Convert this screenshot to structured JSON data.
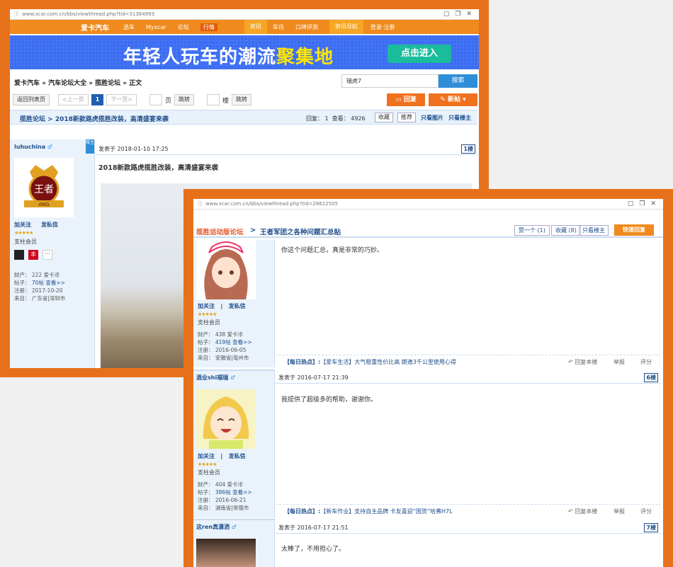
{
  "back": {
    "url": "www.xcar.com.cn/bbs/viewthread.php?tid=31384993",
    "topnav": [
      "爱卡汽车",
      "选车",
      "Myxcar",
      "论坛",
      "行情",
      "资讯",
      "车讯",
      "口碑评测",
      "资讯导航",
      "登录·注册"
    ],
    "banner": {
      "lead": "年轻人玩车的潮流",
      "accent": "聚集地",
      "cta": "点击进入"
    },
    "breadcrumb": "爱卡汽车 » 汽车论坛大全 » 揽胜论坛 » 正文",
    "search": {
      "value": "瑞虎7",
      "button": "搜索"
    },
    "pager": {
      "back": "返回列表页",
      "prev": "<上一页",
      "current": "1",
      "next": "下一页>",
      "page_label": "页",
      "go1": "跳转",
      "floor_label": "楼",
      "go2": "跳转"
    },
    "reply_btn": "回复",
    "new_btn": "新帖",
    "thread": {
      "forum": "揽胜论坛",
      "sep": ">",
      "title": "2018新款路虎揽胜改装，高清盛宴来袭",
      "replies": "回复： 1",
      "views": "查看： 4926",
      "fav": "收藏",
      "recommend": "推荐",
      "only_img": "只看图片",
      "only_owner": "只看楼主"
    },
    "post": {
      "user": "luhuchina",
      "badge": "楼主",
      "follow": "加关注",
      "pm": "发私信",
      "stars": "★★★★★",
      "role": "支柱会员",
      "wealth_label": "财产：",
      "wealth": "222 爱卡币",
      "posts_label": "帖子：",
      "posts": "70帖",
      "view": "查看>>",
      "reg_label": "注册：",
      "reg": "2017-10-20",
      "from_label": "来自：",
      "from": "广东省|深圳市",
      "date": "发表于 2018-01-10 17:25",
      "floor": "1楼",
      "title": "2018新款路虎揽胜改装，高清盛宴来袭",
      "avatar_text": "王者",
      "avatar_sub": "ANG",
      "icon_fan": "丰"
    }
  },
  "front": {
    "url": "www.xcar.com.cn/bbs/viewthread.php?tid=28622505",
    "forum": "揽胜运动版论坛",
    "sep": ">",
    "title": "王者军团之各种问题汇总贴",
    "like": "赞一个 (1)",
    "fav": "收藏 (8)",
    "only_owner": "只看楼主",
    "quick_reply": "快速回复",
    "posts": [
      {
        "user": "",
        "follow": "加关注",
        "pm": "发私信",
        "stars": "★★★★★",
        "role": "支柱会员",
        "wealth": "438 爱卡币",
        "posts": "419帖",
        "view": "查看>>",
        "reg": "2016-06-05",
        "from": "安徽省|亳州市",
        "date": "",
        "floor": "",
        "body": "你这个问题汇总，真是非常的巧妙。",
        "hot": "【每日热点】:",
        "hotlink": "【爱车生活】大气稳重性价比高 朗逸3千公里使用心得"
      },
      {
        "user": "酒业shi福瑞",
        "follow": "加关注",
        "pm": "发私信",
        "stars": "★★★★★",
        "role": "支柱会员",
        "wealth": "404 爱卡币",
        "posts": "386帖",
        "view": "查看>>",
        "reg": "2016-06-21",
        "from": "湖南省|常德市",
        "date": "发表于 2016-07-17 21:39",
        "floor": "6楼",
        "body": "我提供了超级多的帮助，谢谢你。",
        "hot": "【每日热点】:",
        "hotlink": "【新车作业】支持自主品牌 卡友喜迎“国货”哈弗H7L"
      },
      {
        "user": "这ren真潇洒",
        "date": "发表于 2016-07-17 21:51",
        "floor": "7楼",
        "body": "太棒了，不用担心了。"
      }
    ],
    "acts": {
      "reply": "回复本楼",
      "report": "举报",
      "rate": "评分"
    },
    "labels": {
      "wealth": "财产：",
      "posts": "帖子：",
      "reg": "注册：",
      "from": "来自："
    }
  }
}
